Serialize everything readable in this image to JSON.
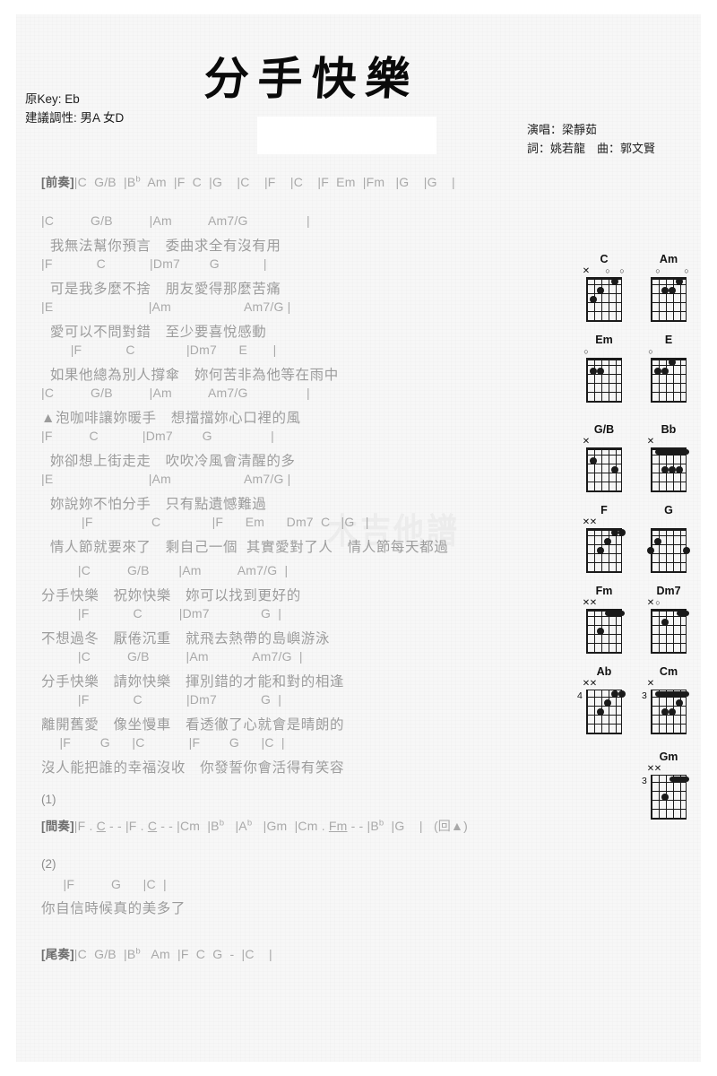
{
  "header": {
    "title": "分手快樂",
    "orig_key": "原Key: Eb",
    "suggested_key": "建議調性: 男A 女D",
    "singer": "演唱：梁靜茹",
    "writers": "詞：姚若龍　曲：郭文賢",
    "watermark": "木吉他譜"
  },
  "intro": {
    "tag": "[前奏]",
    "chords": "|C  G/B  |B♭  Am  |F  C  |G    |C    |F    |C    |F  Em  |Fm   |G    |G    |"
  },
  "sections": [
    {
      "chords": "|C          G/B          |Am          Am7/G                |",
      "lyric": "  我無法幫你預言　委曲求全有沒有用"
    },
    {
      "chords": "|F            C            |Dm7        G            |",
      "lyric": "  可是我多麼不捨　朋友愛得那麼苦痛"
    },
    {
      "chords": "|E                          |Am                    Am7/G |",
      "lyric": "  愛可以不問對錯　至少要喜悅感動"
    },
    {
      "chords": "        |F            C              |Dm7      E       |",
      "lyric": "  如果他總為別人撐傘　妳何苦非為他等在雨中"
    },
    {
      "chords": "|C          G/B          |Am          Am7/G                |",
      "lyric": "▲泡咖啡讓妳暖手　想擋擋妳心口裡的風"
    },
    {
      "chords": "|F          C            |Dm7        G                |",
      "lyric": "  妳卻想上街走走　吹吹冷風會清醒的多"
    },
    {
      "chords": "|E                          |Am                    Am7/G |",
      "lyric": "  妳說妳不怕分手　只有點遺憾難過"
    },
    {
      "chords": "           |F                C              |F      Em      Dm7  C   |G   |",
      "lyric": "  情人節就要來了　剩自己一個  其實愛對了人　情人節每天都過"
    }
  ],
  "chorus": [
    {
      "chords": "          |C          G/B        |Am          Am7/G  |",
      "lyric": "分手快樂　祝妳快樂　妳可以找到更好的"
    },
    {
      "chords": "          |F            C          |Dm7              G  |",
      "lyric": "不想過冬　厭倦沉重　就飛去熱帶的島嶼游泳"
    },
    {
      "chords": "          |C          G/B          |Am            Am7/G  |",
      "lyric": "分手快樂　請妳快樂　揮別錯的才能和對的相逢"
    },
    {
      "chords": "          |F            C            |Dm7            G  |",
      "lyric": "離開舊愛　像坐慢車　看透徹了心就會是晴朗的"
    },
    {
      "chords": "     |F        G      |C            |F        G      |C  |",
      "lyric": "沒人能把誰的幸福沒收　你發誓你會活得有笑容"
    }
  ],
  "markers": {
    "one": "(1)",
    "two": "(2)"
  },
  "interlude": {
    "tag": "[間奏]",
    "parts": [
      {
        "t": "|F . "
      },
      {
        "t": "C",
        "u": true
      },
      {
        "t": " - - |F . "
      },
      {
        "t": "C",
        "u": true
      },
      {
        "t": " - - |Cm  |B"
      },
      {
        "t": "b",
        "sup": true
      },
      {
        "t": "   |A"
      },
      {
        "t": "b",
        "sup": true
      },
      {
        "t": "   |Gm  |Cm . "
      },
      {
        "t": "Fm",
        "u": true
      },
      {
        "t": " - - |B"
      },
      {
        "t": "b",
        "sup": true
      },
      {
        "t": "  |G    |   (回▲)"
      }
    ]
  },
  "verse2": {
    "chords": "      |F          G      |C  |",
    "lyric": "你自信時候真的美多了"
  },
  "outro": {
    "tag": "[尾奏]",
    "chords": "|C  G/B  |B♭   Am  |F  C  G  -  |C    |"
  },
  "diagrams": [
    {
      "name": "C",
      "marks": [
        {
          "s": 6,
          "m": "x"
        },
        {
          "s": 3,
          "m": "o"
        },
        {
          "s": 1,
          "m": "o"
        }
      ],
      "dots": [
        {
          "s": 5,
          "f": 3
        },
        {
          "s": 4,
          "f": 2
        },
        {
          "s": 2,
          "f": 1
        }
      ],
      "barres": [],
      "fret": ""
    },
    {
      "name": "Am",
      "marks": [
        {
          "s": 5,
          "m": "o"
        },
        {
          "s": 1,
          "m": "o"
        }
      ],
      "dots": [
        {
          "s": 4,
          "f": 2
        },
        {
          "s": 3,
          "f": 2
        },
        {
          "s": 2,
          "f": 1
        }
      ],
      "barres": [],
      "fret": ""
    },
    {
      "name": "Em",
      "marks": [
        {
          "s": 6,
          "m": "o"
        }
      ],
      "dots": [
        {
          "s": 5,
          "f": 2
        },
        {
          "s": 4,
          "f": 2
        }
      ],
      "barres": [],
      "fret": ""
    },
    {
      "name": "E",
      "marks": [
        {
          "s": 6,
          "m": "o"
        }
      ],
      "dots": [
        {
          "s": 5,
          "f": 2
        },
        {
          "s": 4,
          "f": 2
        },
        {
          "s": 3,
          "f": 1
        }
      ],
      "barres": [],
      "fret": ""
    },
    {
      "name": "G/B",
      "marks": [
        {
          "s": 6,
          "m": "x"
        }
      ],
      "dots": [
        {
          "s": 5,
          "f": 2
        },
        {
          "s": 2,
          "f": 3
        }
      ],
      "barres": [],
      "fret": ""
    },
    {
      "name": "Bb",
      "marks": [
        {
          "s": 6,
          "m": "x"
        }
      ],
      "dots": [
        {
          "s": 4,
          "f": 3
        },
        {
          "s": 3,
          "f": 3
        },
        {
          "s": 2,
          "f": 3
        }
      ],
      "barres": [
        {
          "f": 1,
          "from": 5,
          "to": 1
        }
      ],
      "fret": ""
    },
    {
      "name": "F",
      "marks": [
        {
          "s": 6,
          "m": "x"
        },
        {
          "s": 5,
          "m": "x"
        }
      ],
      "dots": [
        {
          "s": 4,
          "f": 3
        },
        {
          "s": 3,
          "f": 2
        },
        {
          "s": 2,
          "f": 1
        },
        {
          "s": 1,
          "f": 1
        }
      ],
      "barres": [],
      "fret": ""
    },
    {
      "name": "G",
      "marks": [],
      "dots": [
        {
          "s": 5,
          "f": 2
        },
        {
          "s": 6,
          "f": 3
        },
        {
          "s": 1,
          "f": 3
        }
      ],
      "barres": [],
      "fret": ""
    },
    {
      "name": "Fm",
      "marks": [
        {
          "s": 6,
          "m": "x"
        },
        {
          "s": 5,
          "m": "x"
        }
      ],
      "dots": [
        {
          "s": 4,
          "f": 3
        }
      ],
      "barres": [
        {
          "f": 1,
          "from": 3,
          "to": 1
        }
      ],
      "fret": ""
    },
    {
      "name": "Dm7",
      "marks": [
        {
          "s": 6,
          "m": "x"
        },
        {
          "s": 5,
          "m": "o"
        }
      ],
      "dots": [
        {
          "s": 4,
          "f": 2
        }
      ],
      "barres": [
        {
          "f": 1,
          "from": 2,
          "to": 1
        }
      ],
      "fret": ""
    },
    {
      "name": "Ab",
      "marks": [
        {
          "s": 6,
          "m": "x"
        },
        {
          "s": 5,
          "m": "x"
        }
      ],
      "dots": [
        {
          "s": 4,
          "f": 3
        },
        {
          "s": 3,
          "f": 2
        },
        {
          "s": 2,
          "f": 1
        },
        {
          "s": 1,
          "f": 1
        }
      ],
      "barres": [],
      "fret": "4"
    },
    {
      "name": "Cm",
      "marks": [
        {
          "s": 6,
          "m": "x"
        }
      ],
      "dots": [
        {
          "s": 4,
          "f": 3
        },
        {
          "s": 3,
          "f": 3
        },
        {
          "s": 2,
          "f": 2
        }
      ],
      "barres": [
        {
          "f": 1,
          "from": 5,
          "to": 1
        }
      ],
      "fret": "3"
    },
    {
      "name": "Gm",
      "marks": [
        {
          "s": 6,
          "m": "x"
        },
        {
          "s": 5,
          "m": "x"
        }
      ],
      "dots": [
        {
          "s": 4,
          "f": 3
        }
      ],
      "barres": [
        {
          "f": 1,
          "from": 3,
          "to": 1
        }
      ],
      "fret": "3"
    }
  ]
}
